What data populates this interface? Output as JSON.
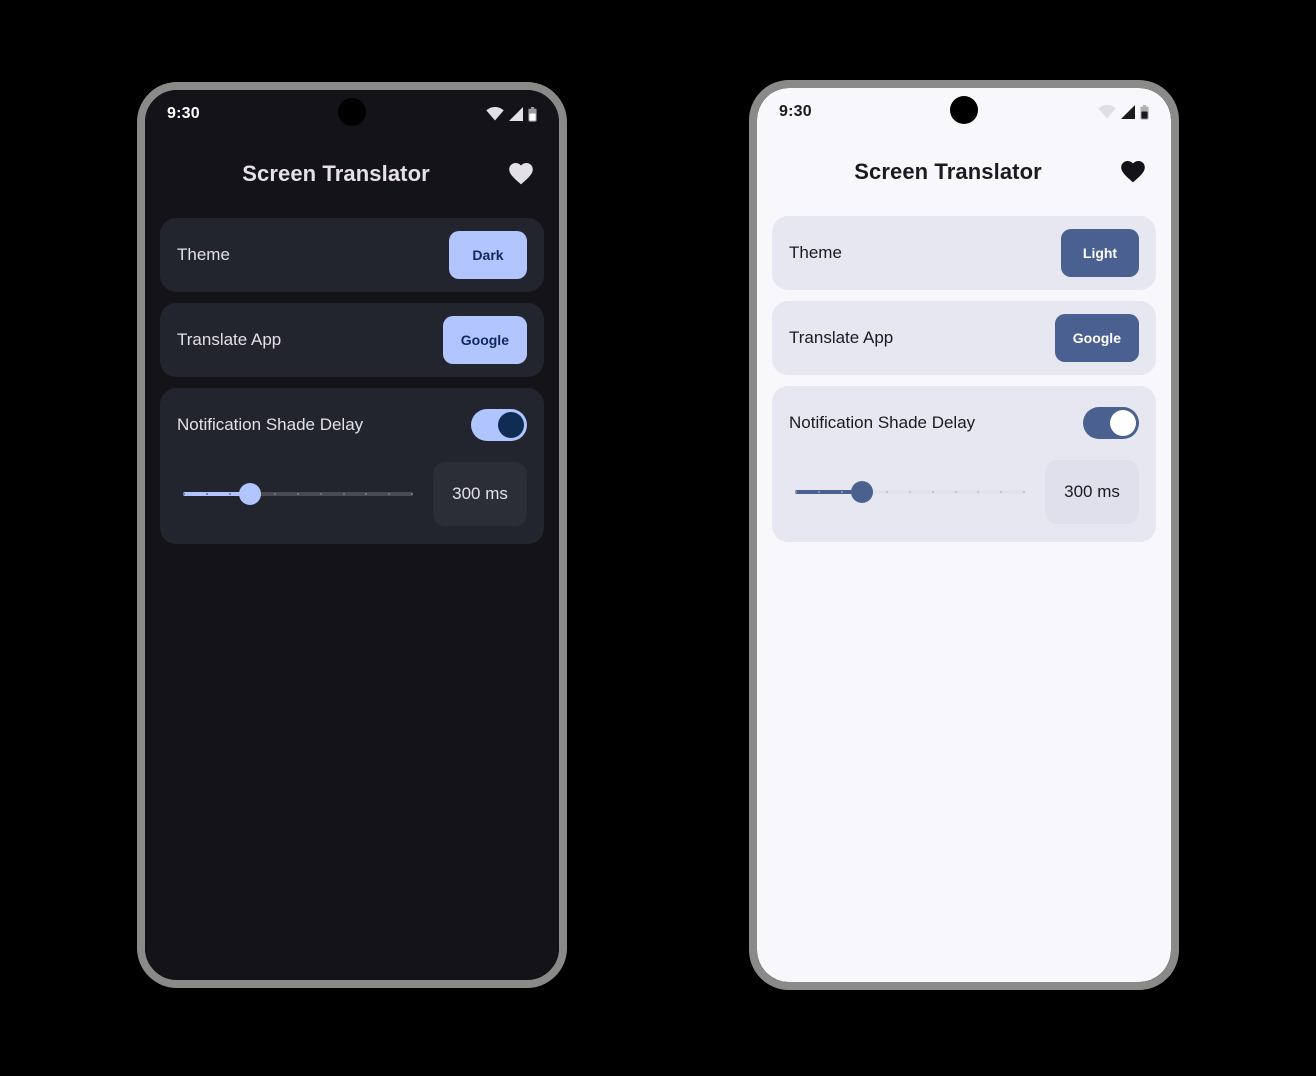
{
  "phones": [
    {
      "id": "dark-phone",
      "mode": "dark",
      "status": {
        "clock": "9:30",
        "icons": [
          "wifi-icon",
          "cellular-signal-icon",
          "battery-icon"
        ]
      },
      "appbar": {
        "title": "Screen Translator",
        "action_icon": "heart-icon"
      },
      "settings": {
        "theme": {
          "label": "Theme",
          "value": "Dark"
        },
        "translate_app": {
          "label": "Translate App",
          "value": "Google"
        },
        "notification_shade_delay": {
          "label": "Notification Shade Delay",
          "enabled": true,
          "toggle_state": "on",
          "value_label": "300 ms",
          "slider": {
            "value": 300,
            "min": 0,
            "max": 1000,
            "step": 100,
            "ticks": 11,
            "percent": 30
          }
        }
      }
    },
    {
      "id": "light-phone",
      "mode": "light",
      "status": {
        "clock": "9:30",
        "icons": [
          "wifi-icon",
          "cellular-signal-icon",
          "battery-icon"
        ]
      },
      "appbar": {
        "title": "Screen Translator",
        "action_icon": "heart-icon"
      },
      "settings": {
        "theme": {
          "label": "Theme",
          "value": "Light"
        },
        "translate_app": {
          "label": "Translate App",
          "value": "Google"
        },
        "notification_shade_delay": {
          "label": "Notification Shade Delay",
          "enabled": true,
          "toggle_state": "on",
          "value_label": "300 ms",
          "slider": {
            "value": 300,
            "min": 0,
            "max": 1000,
            "step": 100,
            "ticks": 11,
            "percent": 30
          }
        }
      }
    }
  ],
  "colors": {
    "background": "#000000",
    "frame": "#8a8a88",
    "dark_screen": "#131318",
    "dark_card": "#22242E",
    "dark_accent": "#B3C5FF",
    "dark_accent_text": "#10295B",
    "light_screen": "#F8F8FC",
    "light_card": "#E6E7F1",
    "light_accent": "#4A6090",
    "light_accent_text": "#FFFFFF"
  }
}
